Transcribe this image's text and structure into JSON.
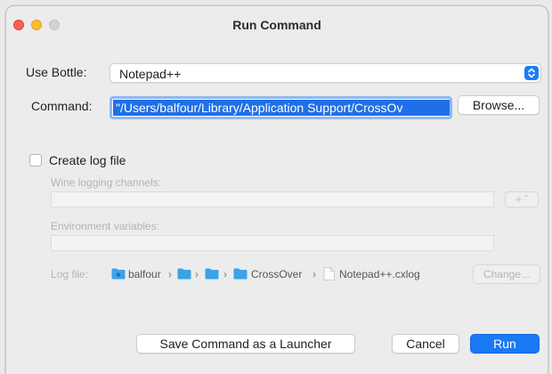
{
  "window": {
    "title": "Run Command"
  },
  "bottle": {
    "label": "Use Bottle:",
    "value": "Notepad++"
  },
  "command": {
    "label": "Command:",
    "value": "\"/Users/balfour/Library/Application Support/CrossOv",
    "browse_label": "Browse..."
  },
  "log": {
    "checkbox_label": "Create log file",
    "checked": false,
    "channels_label": "Wine logging channels:",
    "add_label": "+ ˇ",
    "env_label": "Environment variables:",
    "file_label": "Log file:",
    "path": [
      "balfour",
      "CrossOver",
      "Notepad++.cxlog"
    ],
    "change_label": "Change..."
  },
  "buttons": {
    "save_launcher": "Save Command as a Launcher",
    "cancel": "Cancel",
    "run": "Run"
  },
  "colors": {
    "accent": "#1a79f4",
    "selection": "#1f6fe8"
  }
}
